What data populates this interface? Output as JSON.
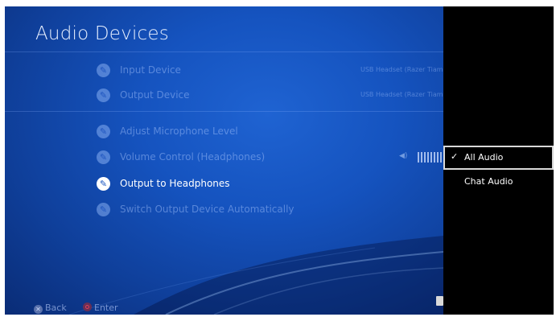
{
  "screen": {
    "title": "Audio Devices"
  },
  "settings": [
    {
      "label": "Input Device",
      "value": "USB Headset (Razer Tiamat...",
      "icon": "wrench-icon",
      "state": "disabled"
    },
    {
      "label": "Output Device",
      "value": "USB Headset (Razer Tiamat...",
      "icon": "wrench-icon",
      "state": "disabled"
    },
    {
      "label": "Adjust Microphone Level",
      "icon": "wrench-icon",
      "state": "disabled"
    },
    {
      "label": "Volume Control (Headphones)",
      "icon": "wrench-icon",
      "state": "disabled",
      "volume_icon": "speaker-icon"
    },
    {
      "label": "Output to Headphones",
      "icon": "wrench-icon",
      "state": "focused"
    },
    {
      "label": "Switch Output Device Automatically",
      "icon": "wrench-icon",
      "state": "disabled"
    }
  ],
  "footer": {
    "back_label": "Back",
    "enter_label": "Enter",
    "back_button_icon": "cross-button-icon",
    "enter_button_icon": "circle-button-icon",
    "options_icon": "options-button-icon"
  },
  "dropdown": {
    "options": [
      {
        "label": "All Audio",
        "selected": true,
        "check": "✓"
      },
      {
        "label": "Chat Audio",
        "selected": false
      }
    ]
  },
  "colors": {
    "background_blue": "#1553bf",
    "panel": "#000000",
    "focus_text": "#ffffff",
    "disabled_text": "#7f9ad6"
  }
}
